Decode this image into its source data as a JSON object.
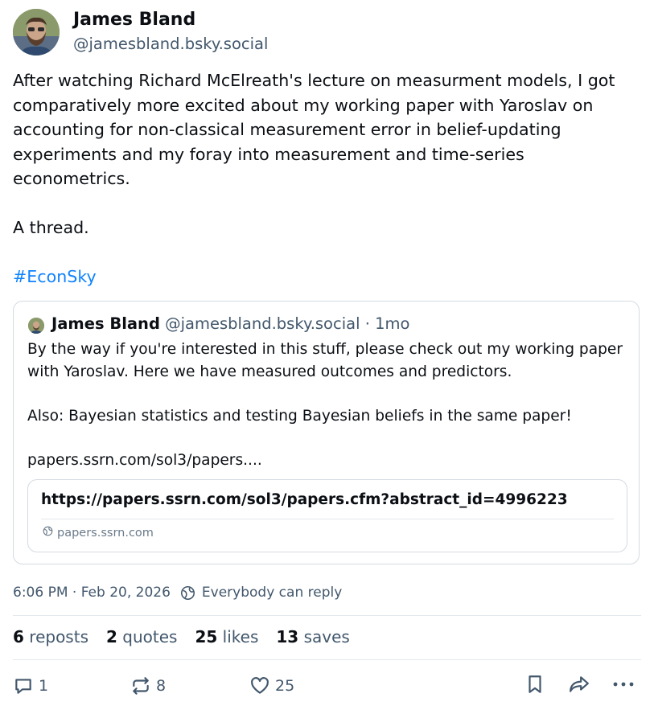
{
  "author": {
    "name": "James Bland",
    "handle": "@jamesbland.bsky.social"
  },
  "post": {
    "paragraphs": [
      "After watching Richard McElreath's lecture on measurment models, I got comparatively more excited about my working paper with Yaroslav on accounting for non-classical measurement error in belief-updating experiments and my foray into measurement and time-series econometrics.",
      "A thread."
    ],
    "hashtag": "#EconSky"
  },
  "quote": {
    "name": "James Bland",
    "handle": "@jamesbland.bsky.social",
    "separator": "·",
    "time": "1mo",
    "paragraphs": [
      "By the way if you're interested in this stuff, please check out my working paper with Yaroslav. Here we have measured outcomes and predictors.",
      "Also: Bayesian statistics and testing Bayesian beliefs in the same paper!",
      "papers.ssrn.com/sol3/papers...."
    ],
    "link_card": {
      "title": "https://papers.ssrn.com/sol3/papers.cfm?abstract_id=4996223",
      "domain": "papers.ssrn.com"
    }
  },
  "meta": {
    "timestamp": "6:06 PM · Feb 20, 2026",
    "reply_setting": "Everybody can reply"
  },
  "counts": {
    "reposts": {
      "value": "6",
      "label": "reposts"
    },
    "quotes": {
      "value": "2",
      "label": "quotes"
    },
    "likes": {
      "value": "25",
      "label": "likes"
    },
    "saves": {
      "value": "13",
      "label": "saves"
    }
  },
  "actions": {
    "reply_count": "1",
    "repost_count": "8",
    "like_count": "25",
    "icons": [
      "reply-icon",
      "repost-icon",
      "like-icon",
      "bookmark-icon",
      "share-icon",
      "more-icon"
    ]
  },
  "colors": {
    "accent": "#1083fe",
    "text": "#0b0f14",
    "muted": "#42576c",
    "border": "#d4dbe2"
  }
}
